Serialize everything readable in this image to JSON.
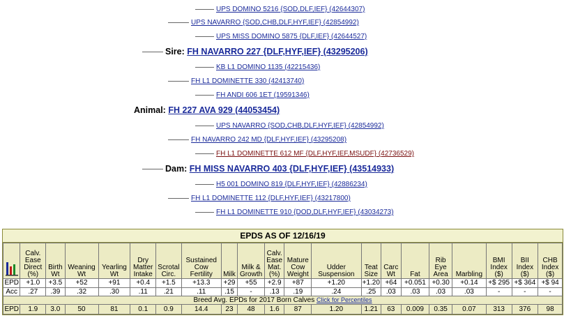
{
  "pedigree": {
    "sire_label": "Sire:",
    "dam_label": "Dam:",
    "animal_label": "Animal:",
    "animal": "FH 227 AVA 929 (44053454)",
    "sire": "FH NAVARRO 227 {DLF,HYF,IEF} (43295206)",
    "dam": "FH MISS NAVARRO 403 {DLF,HYF,IEF} (43514933)",
    "sire_sire": "UPS NAVARRO {SOD,CHB,DLF,HYF,IEF} (42854992)",
    "sire_sire_sire": "UPS DOMINO 5216 {SOD,DLF,IEF} (42644307)",
    "sire_sire_dam": "UPS MISS DOMINO 5875 {DLF,IEF} (42644527)",
    "sire_dam": "FH L1 DOMINETTE 330 (42413740)",
    "sire_dam_sire": "KB L1 DOMINO 1135 (42215436)",
    "sire_dam_dam": "FH ANDI 606 1ET (19591346)",
    "dam_sire": "FH NAVARRO 242 MD {DLF,HYF,IEF} (43295208)",
    "dam_sire_sire": "UPS NAVARRO {SOD,CHB,DLF,HYF,IEF} (42854992)",
    "dam_sire_dam": "FH L1 DOMINETTE 612 MF {DLF,HYF,IEF,MSUDF} (42736529)",
    "dam_dam": "FH L1 DOMINETTE 112 {DLF,HYF,IEF} (43217800)",
    "dam_dam_sire": "H5 001 DOMINO 819 {DLF,HYF,IEF} (42886234)",
    "dam_dam_dam": "FH L1 DOMINETTE 910 {DOD,DLF,HYF,IEF} (43034273)"
  },
  "epd": {
    "title": "EPDS AS OF 12/16/19",
    "chart_icon": "bar-chart-icon",
    "headers": [
      "Calv. Ease Direct (%)",
      "Birth Wt",
      "Weaning Wt",
      "Yearling Wt",
      "Dry Matter Intake",
      "Scrotal Circ.",
      "Sustained Cow Fertility",
      "Milk",
      "Milk & Growth",
      "Calv. Ease Mat. (%)",
      "Mature Cow Weight",
      "Udder Suspension",
      "Teat Size",
      "Carc Wt",
      "Fat",
      "Rib Eye Area",
      "Marbling",
      "BMI Index ($)",
      "BII Index ($)",
      "CHB Index ($)"
    ],
    "epd_label": "EPD",
    "acc_label": "Acc",
    "epd_values": [
      "+1.0",
      "+3.5",
      "+52",
      "+91",
      "+0.4",
      "+1.5",
      "+13.3",
      "+29",
      "+55",
      "+2.9",
      "+87",
      "+1.20",
      "+1.20",
      "+64",
      "+0.051",
      "+0.30",
      "+0.14",
      "+$ 295",
      "+$ 364",
      "+$ 94"
    ],
    "acc_values": [
      ".27",
      ".39",
      ".32",
      ".30",
      ".11",
      ".21",
      ".11",
      ".15",
      "-",
      ".13",
      ".19",
      ".24",
      ".25",
      ".03",
      ".03",
      ".03",
      ".03",
      "-",
      "-",
      "-"
    ],
    "breed_avg_text": "Breed Avg. EPDs for 2017 Born Calves",
    "percentiles_link": "Click for Percentiles",
    "breed_avg_label": "EPD",
    "breed_avg_values": [
      "1.9",
      "3.0",
      "50",
      "81",
      "0.1",
      "0.9",
      "14.4",
      "23",
      "48",
      "1.6",
      "87",
      "1.20",
      "1.21",
      "63",
      "0.009",
      "0.35",
      "0.07",
      "313",
      "376",
      "98"
    ]
  }
}
